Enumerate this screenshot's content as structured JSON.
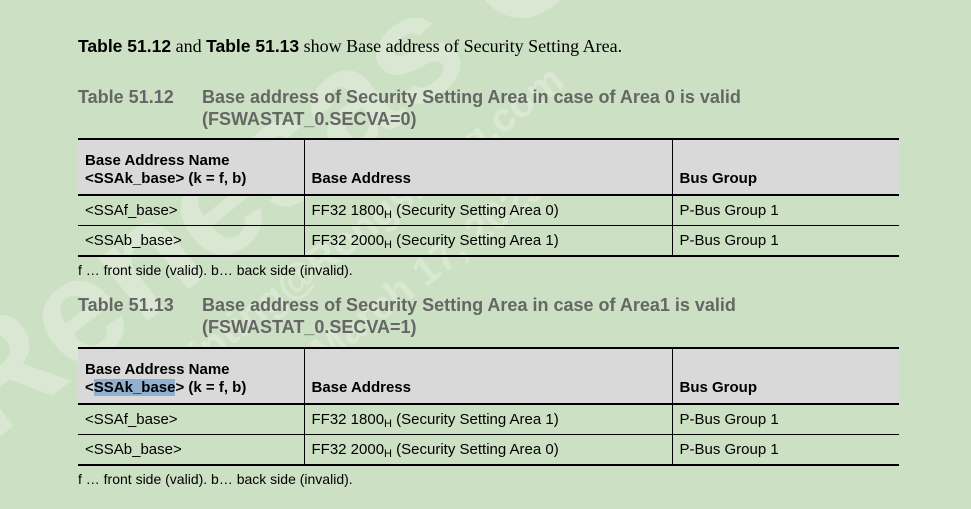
{
  "watermark": {
    "main": "Renesas Confid",
    "line2": "Yutinting@Rongsheng.com",
    "line3": "March 17, 2025"
  },
  "intro": {
    "ref1": "Table 51.12",
    "mid": " and ",
    "ref2": "Table 51.13",
    "rest": " show Base address of Security Setting Area."
  },
  "tables": [
    {
      "number": "Table 51.12",
      "title_line1": "Base address of Security Setting Area in case of Area 0 is valid",
      "title_line2": "(FSWASTAT_0.SECVA=0)",
      "headers": {
        "name_line1": "Base Address Name",
        "name_line2": "<SSAk_base> (k = f, b)",
        "address": "Base Address",
        "bus": "Bus Group"
      },
      "rows": [
        {
          "name": "<SSAf_base>",
          "addr": "FF32 1800",
          "sub": "H",
          "desc": " (Security Setting Area 0)",
          "bus": "P-Bus Group 1"
        },
        {
          "name": "<SSAb_base>",
          "addr": "FF32 2000",
          "sub": "H",
          "desc": " (Security Setting Area 1)",
          "bus": "P-Bus Group 1"
        }
      ],
      "note": "f … front side (valid). b… back side (invalid)."
    },
    {
      "number": "Table 51.13",
      "title_line1": "Base address of Security Setting Area in case of Area1 is valid",
      "title_line2": "(FSWASTAT_0.SECVA=1)",
      "headers": {
        "name_line1": "Base Address Name",
        "name_line2_pre": "<",
        "name_line2_hl": "SSAk_base",
        "name_line2_post": "> (k = f, b)",
        "address": "Base Address",
        "bus": "Bus Group"
      },
      "rows": [
        {
          "name": "<SSAf_base>",
          "addr": "FF32 1800",
          "sub": "H",
          "desc": " (Security Setting Area 1)",
          "bus": "P-Bus Group 1"
        },
        {
          "name": "<SSAb_base>",
          "addr": "FF32 2000",
          "sub": "H",
          "desc": " (Security Setting Area 0)",
          "bus": "P-Bus Group 1"
        }
      ],
      "note": "f … front side (valid). b… back side (invalid)."
    }
  ]
}
